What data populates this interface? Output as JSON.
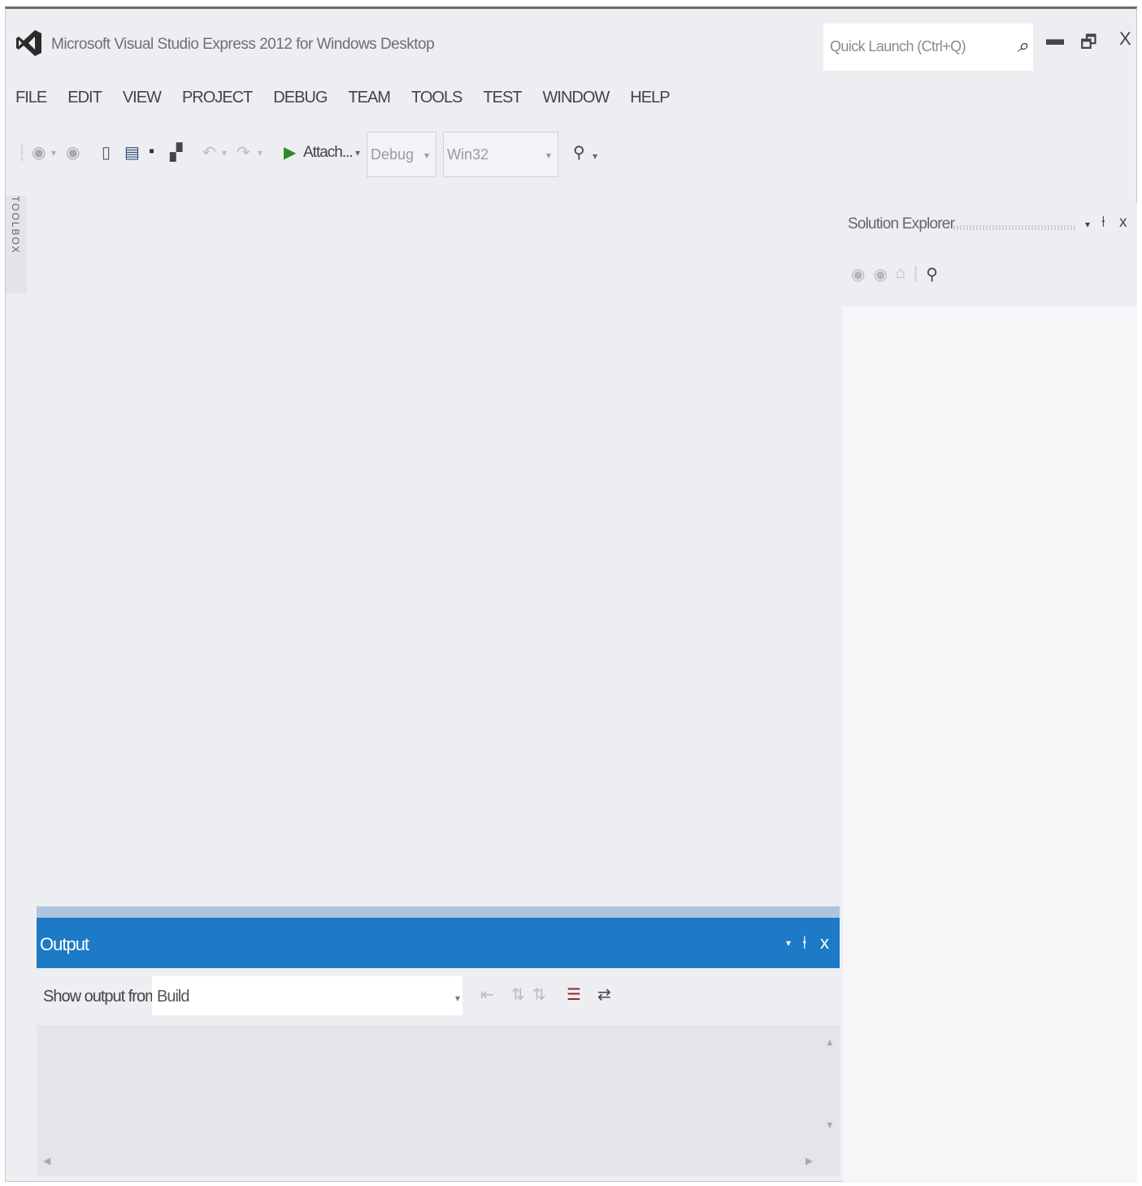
{
  "window": {
    "title": "Microsoft Visual Studio Express 2012 for Windows Desktop",
    "quick_launch_placeholder": "Quick Launch (Ctrl+Q)",
    "minimize_glyph": "▬",
    "restore_glyph": "🗗",
    "close_glyph": "X"
  },
  "menu": [
    "FILE",
    "EDIT",
    "VIEW",
    "PROJECT",
    "DEBUG",
    "TEAM",
    "TOOLS",
    "TEST",
    "WINDOW",
    "HELP"
  ],
  "toolbar": {
    "attach_label": "Attach...",
    "config_value": "Debug",
    "platform_value": "Win32"
  },
  "toolbox_tab": "TOOLBOX",
  "solution_explorer": {
    "title": "Solution Explorer"
  },
  "output": {
    "title": "Output",
    "show_output_label": "Show output from:",
    "source_value": "Build"
  },
  "icons": {
    "search": "search-icon",
    "pin": "pin-icon",
    "dropdown": "chevron-down-icon"
  },
  "colors": {
    "accent": "#1c7ac6",
    "background": "#eceef2"
  }
}
